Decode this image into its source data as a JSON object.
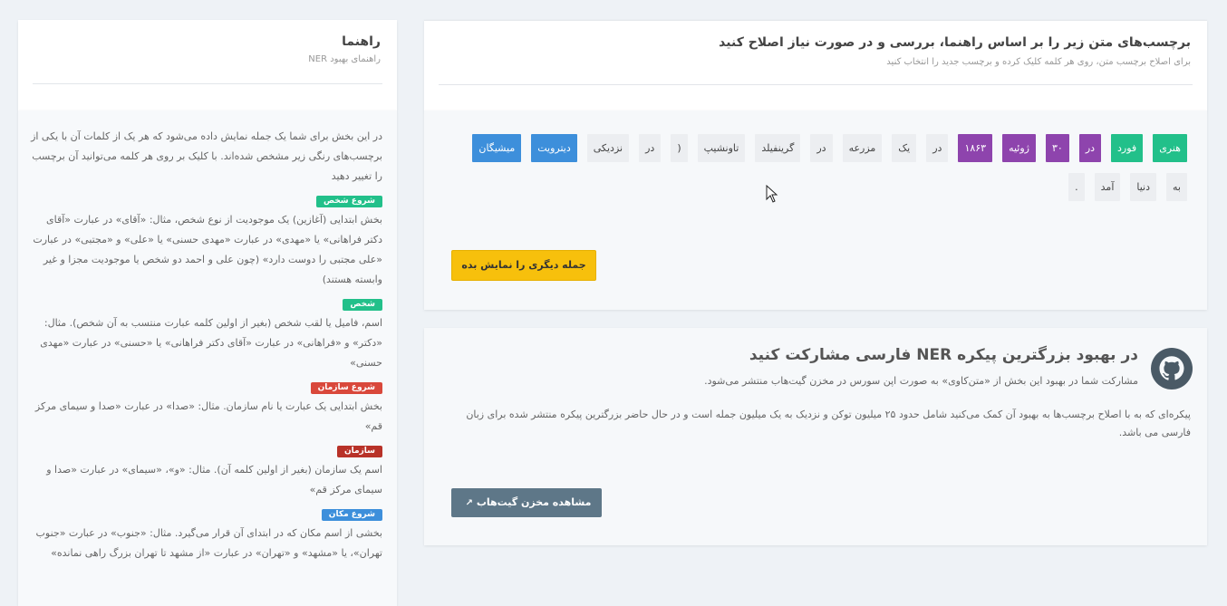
{
  "main": {
    "title": "برچسب‌های متن زیر را بر اساس راهنما، بررسی و در صورت نیاز اصلاح کنید",
    "subtitle": "برای اصلاح برچسب متن، روی هر کلمه کلیک کرده و برچسب جدید را انتخاب کنید",
    "tokens": [
      {
        "text": "هنری",
        "tag": "per-b"
      },
      {
        "text": "فورد",
        "tag": "per-i"
      },
      {
        "text": "در",
        "tag": "date"
      },
      {
        "text": "۳۰",
        "tag": "date"
      },
      {
        "text": "ژوئیه",
        "tag": "date"
      },
      {
        "text": "۱۸۶۳",
        "tag": "date"
      },
      {
        "text": "در",
        "tag": "o"
      },
      {
        "text": "یک",
        "tag": "o"
      },
      {
        "text": "مزرعه",
        "tag": "o"
      },
      {
        "text": "در",
        "tag": "o"
      },
      {
        "text": "گرینفیلد",
        "tag": "o"
      },
      {
        "text": "تاونشیپ",
        "tag": "o"
      },
      {
        "text": "(",
        "tag": "o"
      },
      {
        "text": "در",
        "tag": "o"
      },
      {
        "text": "نزدیکی",
        "tag": "o"
      },
      {
        "text": "دیترویت",
        "tag": "loc"
      },
      {
        "text": "میشیگان",
        "tag": "loc"
      },
      {
        "text": "به",
        "tag": "o"
      },
      {
        "text": "دنیا",
        "tag": "o"
      },
      {
        "text": "آمد",
        "tag": "o"
      },
      {
        "text": ".",
        "tag": "o"
      }
    ],
    "next_button": "جمله دیگری را نمایش بده"
  },
  "repo": {
    "title": "در بهبود بزرگترین پیکره NER فارسی مشارکت کنید",
    "subtitle": "مشارکت شما در بهبود این بخش از «متن‌کاوی» به صورت اپن سورس در مخزن گیت‌هاب منتشر می‌شود.",
    "description": "پیکره‌ای که به با اصلاح برچسب‌ها به بهبود آن کمک می‌کنید شامل حدود ۲۵ میلیون توکن و نزدیک به یک میلیون جمله است و در حال حاضر بزرگترین پیکره منتشر شده برای زبان فارسی می باشد.",
    "button": "مشاهده مخزن گیت‌هاب",
    "icon": "github-icon"
  },
  "guide": {
    "title": "راهنما",
    "subtitle": "راهنمای بهبود NER",
    "intro": "در این بخش برای شما یک جمله نمایش داده می‌شود که هر یک از کلمات آن با یکی از برچسب‌های رنگی زیر مشخص شده‌اند. با کلیک بر روی هر کلمه می‌توانید آن برچسب را تغییر دهید",
    "items": [
      {
        "label": "شروع شخص",
        "color": "#22c08a",
        "text": "بخش ابتدایی (آغازین) یک موجودیت از نوع شخص، مثال: «آقای» در عبارت «آقای دکتر فراهانی» یا «مهدی» در عبارت «مهدی حسنی» یا «علی» و «مجتبی» در عبارت «علی مجتبی را دوست دارد» (چون علی و احمد دو شخص یا موجودیت مجزا و غیر وابسته هستند)"
      },
      {
        "label": "شخص",
        "color": "#22c08a",
        "text": "اسم، فامیل یا لقب شخص (بغیر از اولین کلمه عبارت منتسب به آن شخص). مثال: «دکتر» و «فراهانی» در عبارت «آقای دکتر فراهانی» یا «حسنی» در عبارت «مهدی حسنی»"
      },
      {
        "label": "شروع سازمان",
        "color": "#d9483b",
        "text": "بخش ابتدایی یک عبارت یا نام سازمان. مثال: «صدا» در عبارت «صدا و سیمای مرکز قم»"
      },
      {
        "label": "سازمان",
        "color": "#b83228",
        "text": "اسم یک سازمان (بغیر از اولین کلمه آن). مثال: «و»، «سیمای» در عبارت «صدا و سیمای مرکز قم»"
      },
      {
        "label": "شروع مکان",
        "color": "#3d8fdb",
        "text": "بخشی از اسم مکان که در ابتدای آن قرار می‌گیرد. مثال: «جنوب» در عبارت «جنوب تهران»، یا «مشهد» و «تهران» در عبارت «از مشهد تا تهران بزرگ راهی نمانده»"
      }
    ]
  }
}
